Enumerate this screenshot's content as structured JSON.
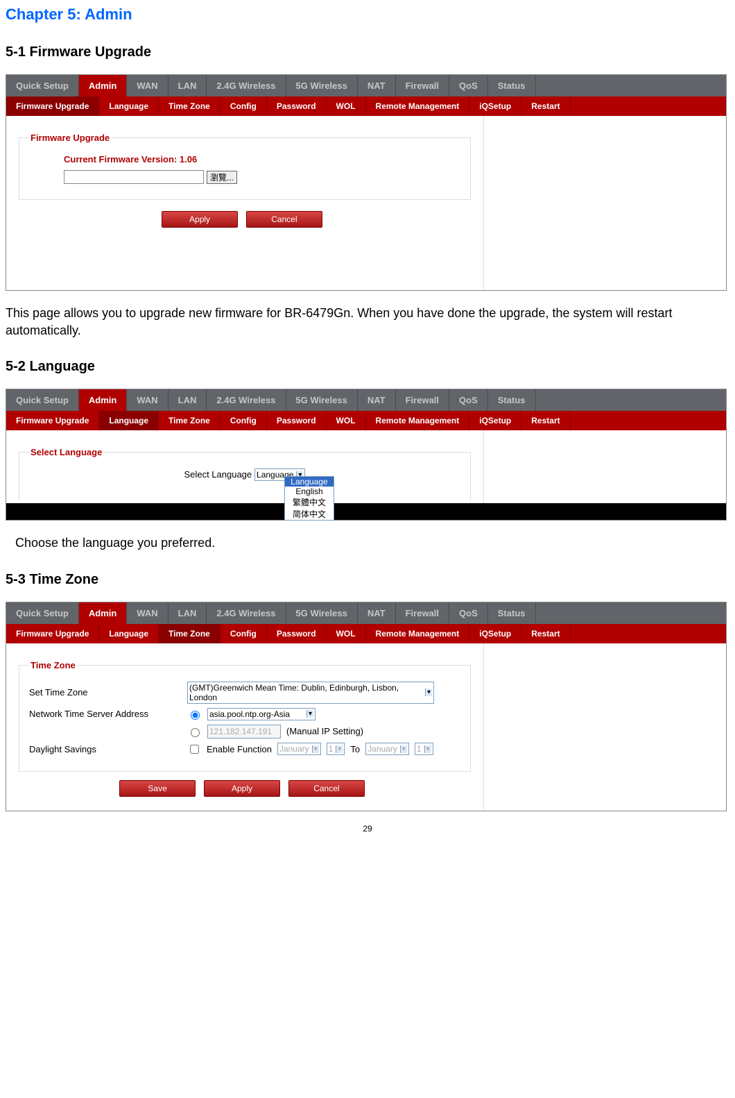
{
  "chapter_title": "Chapter 5: Admin",
  "section1": {
    "heading": "5-1 Firmware Upgrade",
    "main_tabs": [
      "Quick Setup",
      "Admin",
      "WAN",
      "LAN",
      "2.4G Wireless",
      "5G Wireless",
      "NAT",
      "Firewall",
      "QoS",
      "Status"
    ],
    "active_main": 1,
    "sub_tabs": [
      "Firmware Upgrade",
      "Language",
      "Time Zone",
      "Config",
      "Password",
      "WOL",
      "Remote Management",
      "iQSetup",
      "Restart"
    ],
    "active_sub": 0,
    "legend": "Firmware Upgrade",
    "version_label": "Current Firmware Version: 1.06",
    "browse_label": "瀏覽...",
    "apply": "Apply",
    "cancel": "Cancel",
    "paragraph": "This page allows you to upgrade new firmware for BR-6479Gn. When you have done the upgrade, the system will restart automatically."
  },
  "section2": {
    "heading": "5-2 Language",
    "main_tabs": [
      "Quick Setup",
      "Admin",
      "WAN",
      "LAN",
      "2.4G Wireless",
      "5G Wireless",
      "NAT",
      "Firewall",
      "QoS",
      "Status"
    ],
    "active_main": 1,
    "sub_tabs": [
      "Firmware Upgrade",
      "Language",
      "Time Zone",
      "Config",
      "Password",
      "WOL",
      "Remote Management",
      "iQSetup",
      "Restart"
    ],
    "active_sub": 1,
    "legend": "Select Language",
    "select_label": "Select Language",
    "dropdown_value": "Language",
    "options": [
      "Language",
      "English",
      "繁體中文",
      "简体中文"
    ],
    "selected_option_index": 0,
    "paragraph": "Choose the language you preferred."
  },
  "section3": {
    "heading": "5-3 Time Zone",
    "main_tabs": [
      "Quick Setup",
      "Admin",
      "WAN",
      "LAN",
      "2.4G Wireless",
      "5G Wireless",
      "NAT",
      "Firewall",
      "QoS",
      "Status"
    ],
    "active_main": 1,
    "sub_tabs": [
      "Firmware Upgrade",
      "Language",
      "Time Zone",
      "Config",
      "Password",
      "WOL",
      "Remote Management",
      "iQSetup",
      "Restart"
    ],
    "active_sub": 2,
    "legend": "Time Zone",
    "set_tz_label": "Set Time Zone",
    "tz_value": "(GMT)Greenwich Mean Time: Dublin, Edinburgh, Lisbon, London",
    "nts_label": "Network Time Server Address",
    "nts_value": "asia.pool.ntp.org-Asia",
    "manual_ip": "121.182.147.191",
    "manual_ip_label": "(Manual IP Setting)",
    "daylight_label": "Daylight Savings",
    "enable_label": "Enable Function",
    "month": "January",
    "day": "1",
    "to": "To",
    "save": "Save",
    "apply": "Apply",
    "cancel": "Cancel"
  },
  "page_number": "29"
}
